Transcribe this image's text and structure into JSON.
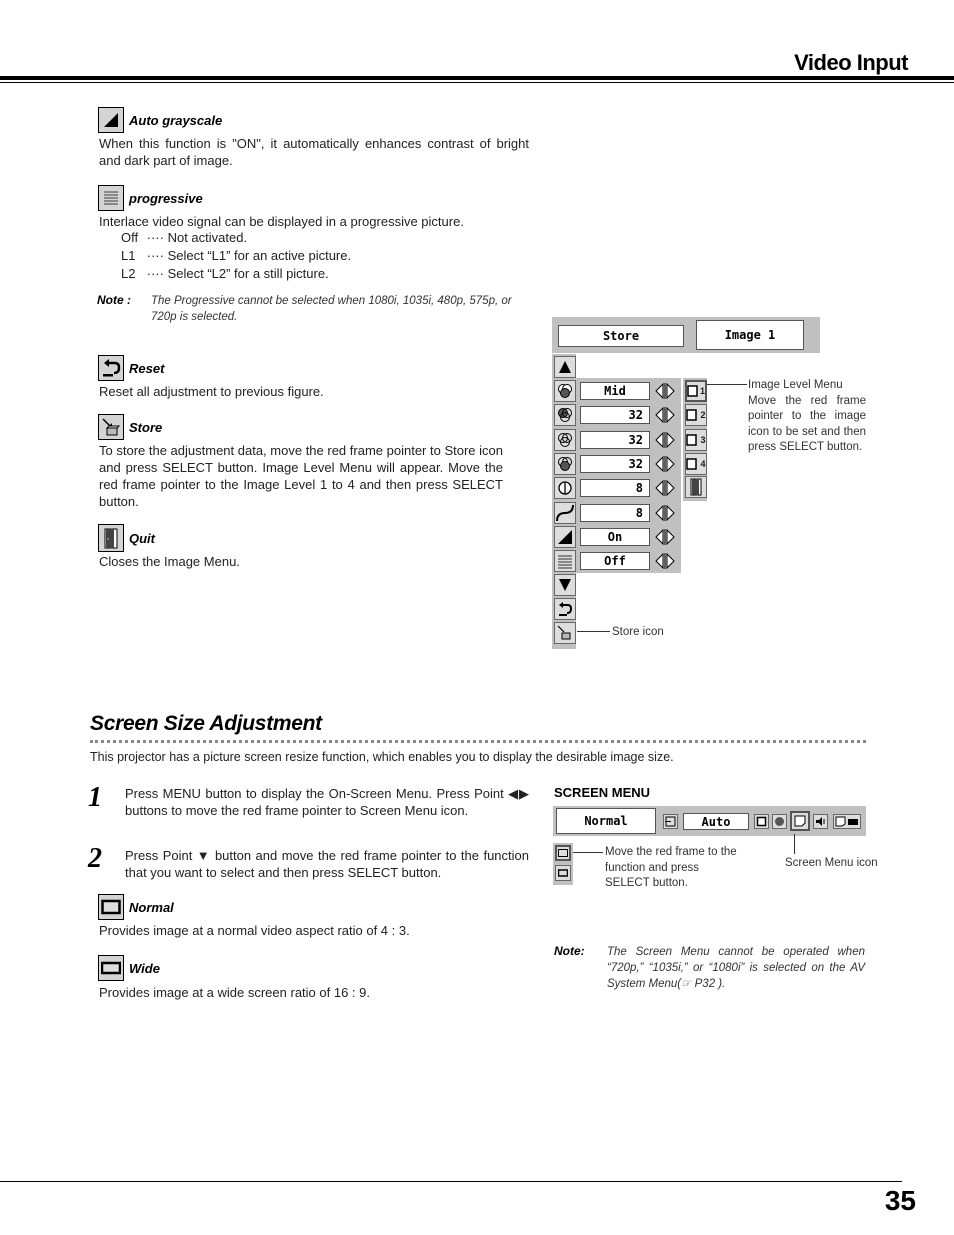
{
  "header": {
    "title": "Video Input"
  },
  "items": [
    {
      "icon": "auto-grayscale-icon",
      "title": "Auto grayscale",
      "text": "When this function is \"ON\", it automatically enhances contrast of bright and dark part of image."
    },
    {
      "icon": "progressive-icon",
      "title": "progressive",
      "text": "Interlace video signal can be displayed in a progressive picture.",
      "options": [
        {
          "key": "Off",
          "sep": "····",
          "desc": "Not activated."
        },
        {
          "key": "L1",
          "sep": "····",
          "desc": "Select “L1” for an active picture."
        },
        {
          "key": "L2",
          "sep": "····",
          "desc": "Select “L2” for a still picture."
        }
      ]
    },
    {
      "icon": "reset-icon",
      "title": "Reset",
      "text": "Reset all adjustment to previous figure."
    },
    {
      "icon": "store-icon",
      "title": "Store",
      "text": "To store the adjustment data, move the red frame pointer to Store icon and press SELECT button.  Image Level Menu will appear.  Move the red frame pointer to the Image Level 1 to 4 and then press SELECT button."
    },
    {
      "icon": "quit-icon",
      "title": "Quit",
      "text": "Closes the Image Menu."
    }
  ],
  "note1": {
    "label": "Note :",
    "text": "The Progressive cannot be selected when 1080i, 1035i, 480p, 575p, or 720p is selected."
  },
  "image_menu": {
    "header_left": "Store",
    "header_right": "Image 1",
    "rows": [
      {
        "icon": "color-balance-icon",
        "value": "Mid"
      },
      {
        "icon": "color-red-icon",
        "value": "32"
      },
      {
        "icon": "color-green-icon",
        "value": "32"
      },
      {
        "icon": "color-blue-icon",
        "value": "32"
      },
      {
        "icon": "sharpness-icon",
        "value": "8"
      },
      {
        "icon": "gamma-icon",
        "value": "8"
      },
      {
        "icon": "auto-grayscale-icon",
        "value": "On"
      },
      {
        "icon": "progressive-icon",
        "value": "Off"
      }
    ],
    "levels": [
      "1",
      "2",
      "3",
      "4"
    ],
    "callout_level": "Image Level Menu\nMove the red frame pointer to the image icon to be set and then press SELECT button.",
    "callout_store": "Store icon"
  },
  "screen_section": {
    "title": "Screen Size Adjustment",
    "intro": "This projector has a picture screen resize function, which enables you to display the desirable image size.",
    "steps": [
      {
        "num": "1",
        "text": "Press MENU button to display the On-Screen Menu.  Press Point ◀▶ buttons to move the red frame pointer to Screen Menu icon."
      },
      {
        "num": "2",
        "text": "Press Point ▼ button and move the red frame pointer to the function that you want to select and then press SELECT button."
      }
    ],
    "items": [
      {
        "title": "Normal",
        "text": "Provides image at a normal video aspect ratio of 4 : 3."
      },
      {
        "title": "Wide",
        "text": "Provides image at a wide screen ratio of 16 : 9."
      }
    ],
    "screen_menu": {
      "label": "SCREEN MENU",
      "field_left": "Normal",
      "field_mid": "Auto",
      "callout_move": "Move the red frame to the function and press SELECT button.",
      "callout_icon": "Screen Menu icon"
    },
    "note": {
      "label": "Note:",
      "text": "The Screen Menu cannot be operated when “720p,” “1035i,” or “1080i” is selected on the AV System Menu(☞ P32 )."
    }
  },
  "footer": {
    "page_number": "35"
  }
}
